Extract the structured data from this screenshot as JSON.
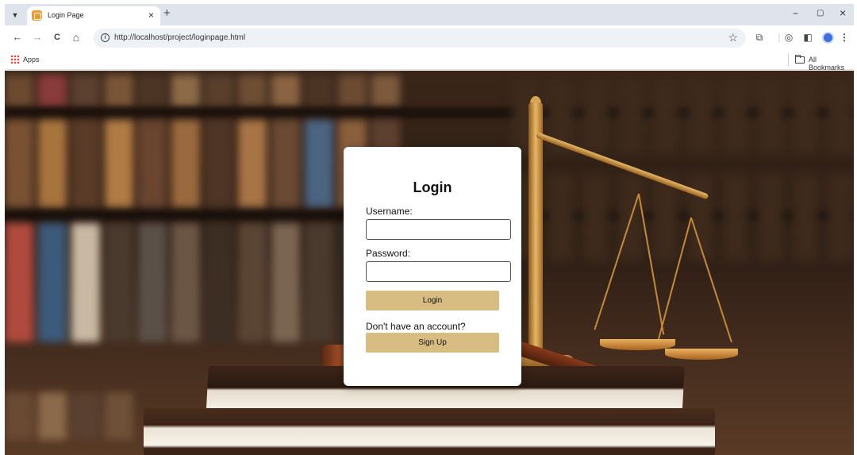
{
  "browser": {
    "tab": {
      "title": "Login Page",
      "close": "×"
    },
    "new_tab": "+",
    "window_controls": {
      "minimize": "−",
      "restore": "▢",
      "close": "×"
    },
    "nav": {
      "back": "←",
      "forward": "→",
      "reload": "C",
      "home": "⌂"
    },
    "address": {
      "url": "http://localhost/project/loginpage.html"
    },
    "bookmarks": {
      "apps": "Apps",
      "all_bookmarks": "All Bookmarks"
    }
  },
  "login": {
    "title": "Login",
    "username_label": "Username:",
    "username_value": "",
    "password_label": "Password:",
    "password_value": "",
    "login_button": "Login",
    "signup_prompt": "Don't have an account?",
    "signup_button": "Sign Up",
    "button_color": "#d8bd83"
  }
}
